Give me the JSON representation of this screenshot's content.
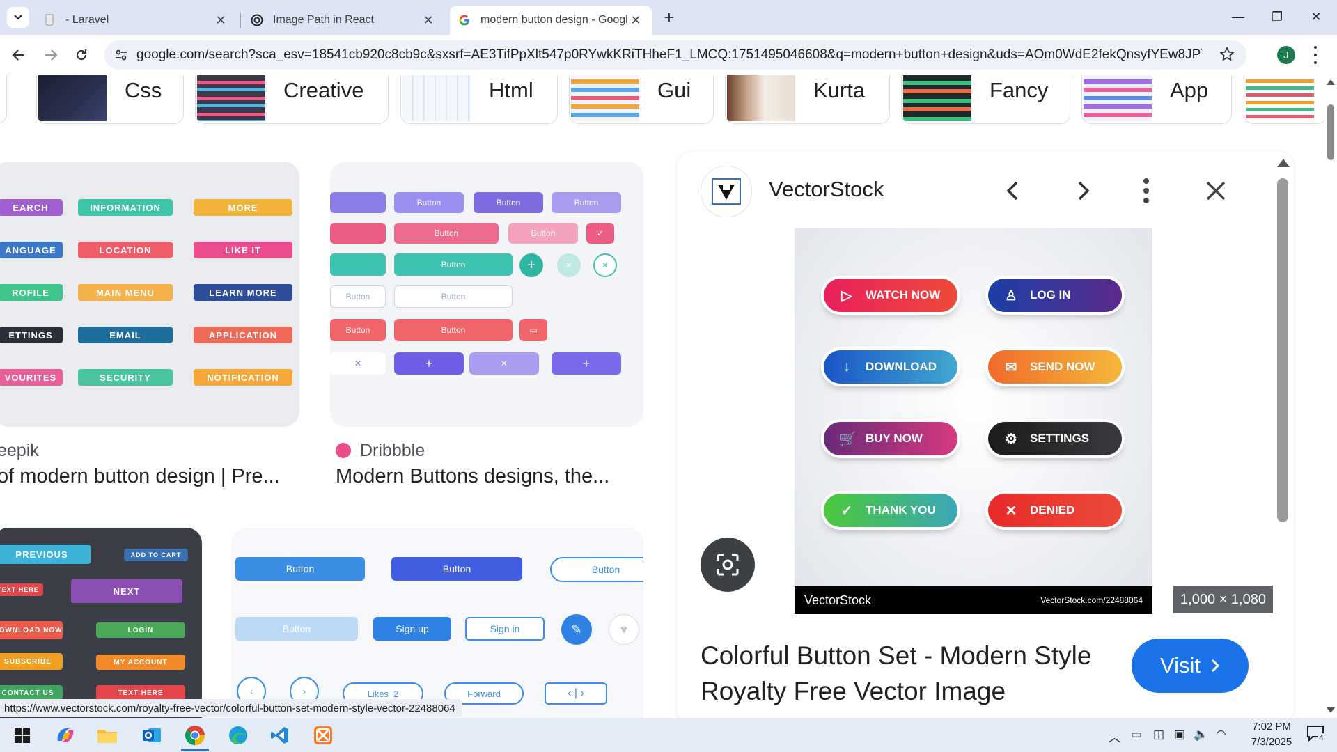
{
  "browser": {
    "tabs": [
      {
        "title": "- Laravel",
        "favicon": "laravel-icon",
        "active": false
      },
      {
        "title": "Image Path in React",
        "favicon": "openai-icon",
        "active": false
      },
      {
        "title": "modern button design - Google",
        "favicon": "google-icon",
        "active": true
      }
    ],
    "new_tab": "+",
    "url": "google.com/search?sca_esv=18541cb920c8cb9c&sxsrf=AE3TifPpXlt547p0RYwkKRiTHheF1_LMCQ:1751495046608&q=modern+button+design&uds=AOm0WdE2fekQnsyfYEw8JPYozOKz1k5FOFl3PppK...",
    "profile_initial": "J"
  },
  "chips": [
    "Css",
    "Creative",
    "Html",
    "Gui",
    "Kurta",
    "Fancy",
    "App"
  ],
  "results": [
    {
      "source": "eepik",
      "title": "of modern button design | Pre...",
      "buttons": [
        "EARCH",
        "INFORMATION",
        "MORE",
        "ANGUAGE",
        "LOCATION",
        "LIKE IT",
        "ROFILE",
        "MAIN MENU",
        "LEARN MORE",
        "ETTINGS",
        "EMAIL",
        "APPLICATION",
        "VOURITES",
        "SECURITY",
        "NOTIFICATION"
      ]
    },
    {
      "source": "Dribbble",
      "title": "Modern Buttons designs, the...",
      "button_label": "Button"
    }
  ],
  "lower_results": {
    "left_buttons": [
      "PREVIOUS",
      "ADD TO CART",
      "TEXT HERE",
      "NEXT",
      "DOWNLOAD NOW",
      "LOGIN",
      "SUBSCRIBE",
      "MY ACCOUNT",
      "CONTACT US",
      "TEXT HERE"
    ],
    "right_buttons": [
      "Button",
      "Button",
      "Button",
      "Button",
      "Sign up",
      "Sign in",
      "Likes",
      "2",
      "Forward"
    ]
  },
  "panel": {
    "site": "VectorStock",
    "image_buttons": [
      {
        "label": "WATCH NOW",
        "icon": "play-icon"
      },
      {
        "label": "LOG IN",
        "icon": "user-icon"
      },
      {
        "label": "DOWNLOAD",
        "icon": "download-icon"
      },
      {
        "label": "SEND NOW",
        "icon": "mail-icon"
      },
      {
        "label": "BUY NOW",
        "icon": "cart-icon"
      },
      {
        "label": "SETTINGS",
        "icon": "gear-icon"
      },
      {
        "label": "THANK YOU",
        "icon": "check-icon"
      },
      {
        "label": "DENIED",
        "icon": "x-icon"
      }
    ],
    "watermark_left": "VectorStock",
    "watermark_right": "VectorStock.com/22488064",
    "dimensions": "1,000 × 1,080",
    "title": "Colorful Button Set - Modern Style Royalty Free Vector Image",
    "visit": "Visit"
  },
  "status_url": "https://www.vectorstock.com/royalty-free-vector/colorful-button-set-modern-style-vector-22488064",
  "taskbar": {
    "time": "7:02 PM",
    "date": "7/3/2025",
    "notification_count": "4"
  }
}
